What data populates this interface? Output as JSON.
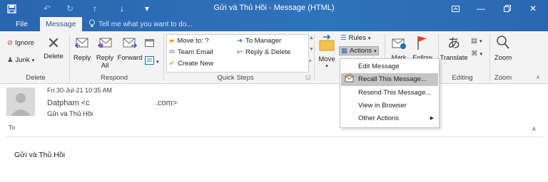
{
  "window": {
    "title": "Gửi và Thủ Hồi - Message (HTML)"
  },
  "tabs": [
    {
      "label": "File"
    },
    {
      "label": "Message"
    }
  ],
  "tell_me": "Tell me what you want to do...",
  "ribbon": {
    "delete_group": {
      "label": "Delete",
      "ignore": "Ignore",
      "junk": "Junk",
      "delete": "Delete"
    },
    "respond_group": {
      "label": "Respond",
      "reply": "Reply",
      "reply_all_1": "Reply",
      "reply_all_2": "All",
      "forward": "Forward"
    },
    "quick_steps": {
      "label": "Quick Steps",
      "items": [
        "Move to: ?",
        "To Manager",
        "Team Email",
        "Reply & Delete",
        "Create New"
      ]
    },
    "move_group": {
      "move": "Move",
      "rules": "Rules",
      "actions": "Actions"
    },
    "tags_group": {
      "mark": "Mark",
      "follow": "Follow"
    },
    "editing_group": {
      "label": "Editing",
      "translate": "Translate"
    },
    "zoom_group": {
      "label": "Zoom",
      "zoom": "Zoom"
    }
  },
  "actions_menu": {
    "items": [
      "Edit Message",
      "Recall This Message...",
      "Resend This Message...",
      "View in Browser",
      "Other Actions"
    ],
    "highlighted_index": 1
  },
  "message": {
    "date": "Fri 30-Jul-21 10:35 AM",
    "sender_name": "Datpham <c",
    "sender_domain": ".com>",
    "subject": "Gửi và Thủ Hồi",
    "to_label": "To",
    "body": "Gửi và Thủ Hồi"
  }
}
